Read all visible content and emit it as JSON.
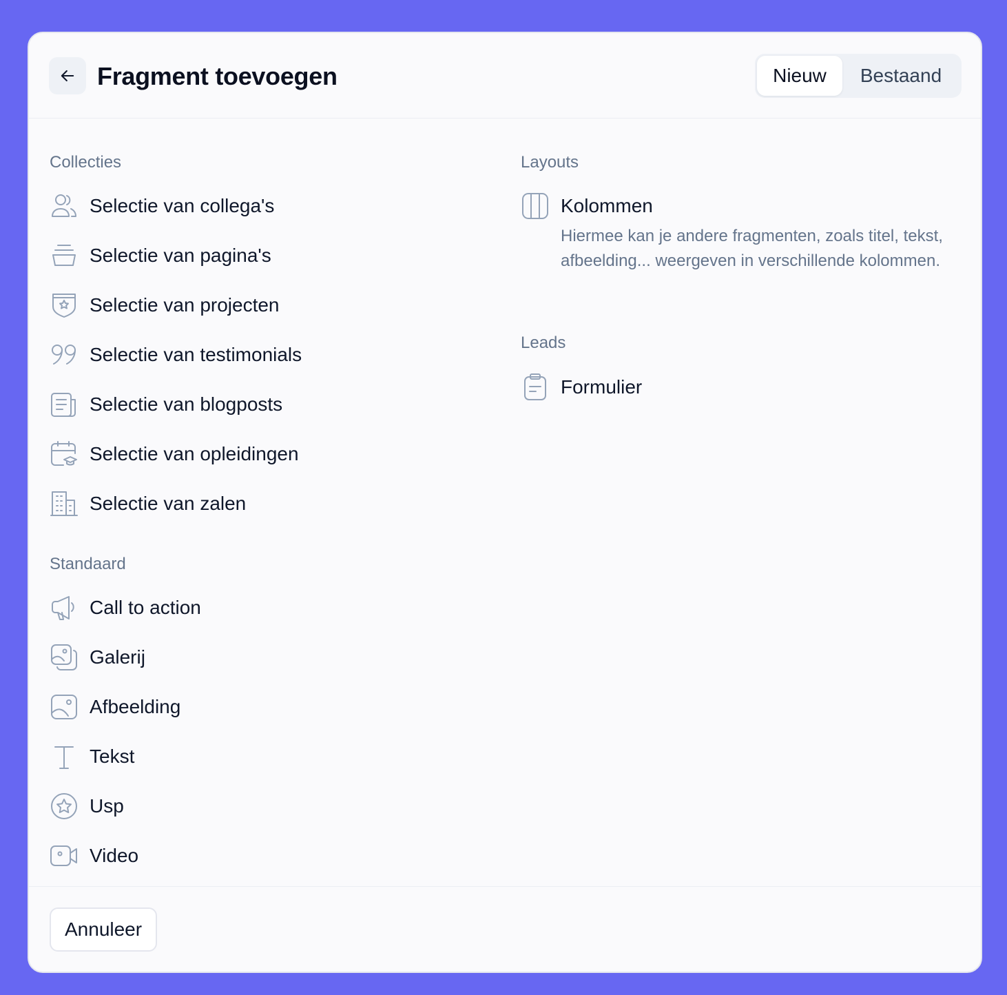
{
  "dialog": {
    "title": "Fragment toevoegen",
    "tabs": [
      {
        "label": "Nieuw",
        "active": true
      },
      {
        "label": "Bestaand",
        "active": false
      }
    ]
  },
  "collecties": {
    "heading": "Collecties",
    "items": [
      {
        "label": "Selectie van collega's",
        "icon": "users-icon"
      },
      {
        "label": "Selectie van pagina's",
        "icon": "stack-icon"
      },
      {
        "label": "Selectie van projecten",
        "icon": "shield-star-icon"
      },
      {
        "label": "Selectie van testimonials",
        "icon": "quote-icon"
      },
      {
        "label": "Selectie van blogposts",
        "icon": "newspaper-icon"
      },
      {
        "label": "Selectie van opleidingen",
        "icon": "calendar-graduation-icon"
      },
      {
        "label": "Selectie van zalen",
        "icon": "building-icon"
      }
    ]
  },
  "standaard": {
    "heading": "Standaard",
    "items": [
      {
        "label": "Call to action",
        "icon": "megaphone-icon"
      },
      {
        "label": "Galerij",
        "icon": "gallery-icon"
      },
      {
        "label": "Afbeelding",
        "icon": "image-icon"
      },
      {
        "label": "Tekst",
        "icon": "text-icon"
      },
      {
        "label": "Usp",
        "icon": "star-circle-icon"
      },
      {
        "label": "Video",
        "icon": "video-icon"
      }
    ]
  },
  "layouts": {
    "heading": "Layouts",
    "items": [
      {
        "label": "Kolommen",
        "icon": "columns-icon",
        "description": "Hiermee kan je andere fragmenten, zoals titel, tekst, afbeelding... weergeven in verschillende kolommen."
      }
    ]
  },
  "leads": {
    "heading": "Leads",
    "items": [
      {
        "label": "Formulier",
        "icon": "clipboard-icon"
      }
    ]
  },
  "footer": {
    "cancel_label": "Annuleer"
  },
  "colors": {
    "background": "#6767f2",
    "panel": "#fafafc",
    "icon": "#94a3b8",
    "muted_text": "#64748b"
  }
}
